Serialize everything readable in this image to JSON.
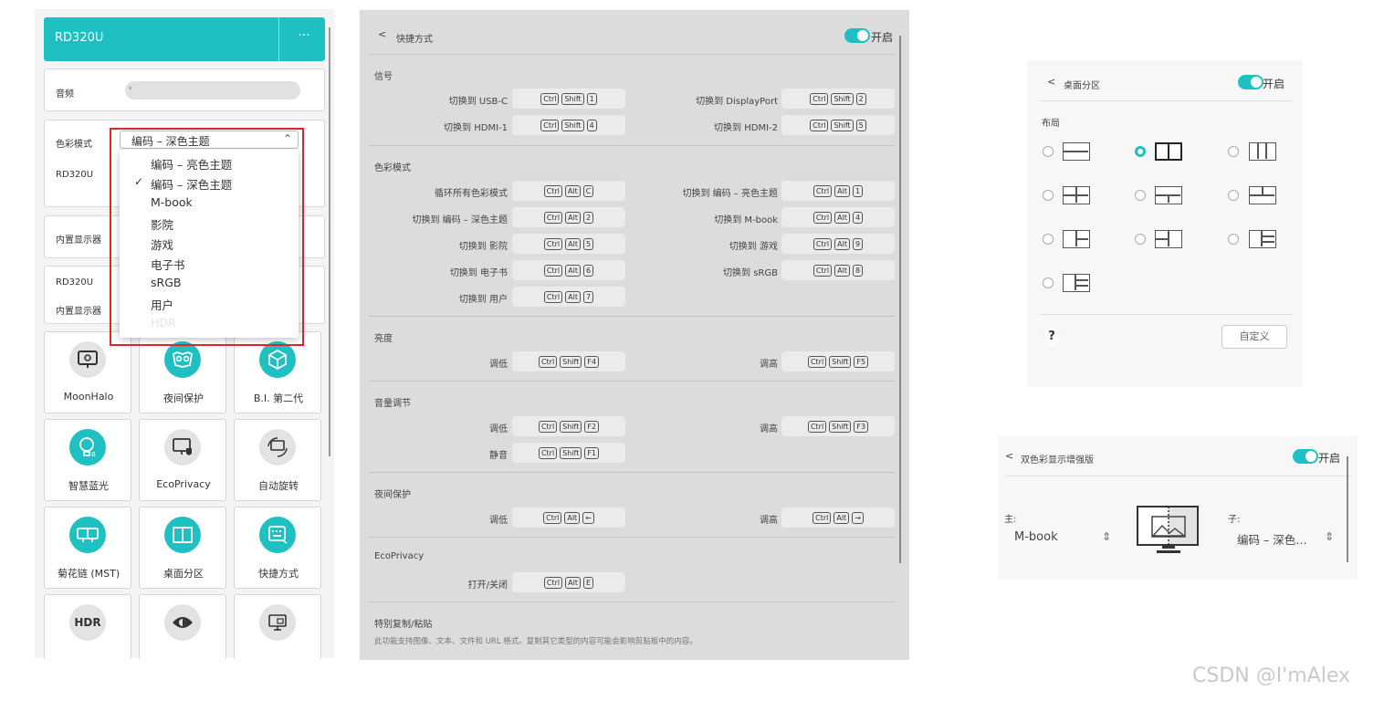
{
  "panel1": {
    "header": {
      "title": "RD320U",
      "more": "···"
    },
    "audio": {
      "label": "音频",
      "icon": "speaker-icon"
    },
    "color_mode": {
      "label": "色彩模式",
      "selected": "编码 – 深色主题",
      "secondary_label": "RD320U",
      "options": [
        {
          "label": "编码 – 亮色主题",
          "checked": false
        },
        {
          "label": "编码 – 深色主题",
          "checked": true
        },
        {
          "label": "M-book",
          "checked": false
        },
        {
          "label": "影院",
          "checked": false
        },
        {
          "label": "游戏",
          "checked": false
        },
        {
          "label": "电子书",
          "checked": false
        },
        {
          "label": "sRGB",
          "checked": false
        },
        {
          "label": "用户",
          "checked": false
        },
        {
          "label": "HDR",
          "checked": false
        }
      ]
    },
    "builtin_display_1": {
      "label": "内置显示器"
    },
    "display_pair": {
      "top": "RD320U",
      "bottom": "内置显示器"
    },
    "tiles": [
      {
        "label": "MoonHalo",
        "icon": "moonhalo-icon",
        "style": "gray"
      },
      {
        "label": "夜间保护",
        "icon": "owl-icon",
        "style": "teal"
      },
      {
        "label": "B.I. 第二代",
        "icon": "cube-icon",
        "style": "teal"
      },
      {
        "label": "智慧蓝光",
        "icon": "bulb-icon",
        "style": "teal"
      },
      {
        "label": "EcoPrivacy",
        "icon": "privacy-icon",
        "style": "gray"
      },
      {
        "label": "自动旋转",
        "icon": "rotate-icon",
        "style": "gray"
      },
      {
        "label": "菊花链 (MST)",
        "icon": "daisy-chain-icon",
        "style": "teal"
      },
      {
        "label": "桌面分区",
        "icon": "desktop-partition-icon",
        "style": "teal"
      },
      {
        "label": "快捷方式",
        "icon": "keyboard-icon",
        "style": "teal"
      },
      {
        "label": "",
        "icon": "hdr-icon",
        "style": "gray",
        "badge": "HDR"
      },
      {
        "label": "",
        "icon": "eye-icon",
        "style": "gray"
      },
      {
        "label": "",
        "icon": "monitor-icon",
        "style": "gray"
      }
    ]
  },
  "panel2": {
    "back": "<",
    "title": "快捷方式",
    "toggle_label": "开启",
    "sections": {
      "signal": "信号",
      "color": "色彩模式",
      "brightness": "亮度",
      "volume": "音量调节",
      "night": "夜间保护",
      "eco": "EcoPrivacy",
      "copy": "特别复制/粘贴"
    },
    "rows": {
      "usbc": {
        "label": "切换到 USB-C",
        "keys": [
          "Ctrl",
          "Shift",
          "1"
        ]
      },
      "dp": {
        "label": "切换到 DisplayPort",
        "keys": [
          "Ctrl",
          "Shift",
          "2"
        ]
      },
      "hdmi1": {
        "label": "切换到 HDMI-1",
        "keys": [
          "Ctrl",
          "Shift",
          "4"
        ]
      },
      "hdmi2": {
        "label": "切换到 HDMI-2",
        "keys": [
          "Ctrl",
          "Shift",
          "5"
        ]
      },
      "cycle": {
        "label": "循环所有色彩模式",
        "keys": [
          "Ctrl",
          "Alt",
          "C"
        ]
      },
      "code_light": {
        "label": "切换到 编码 – 亮色主题",
        "keys": [
          "Ctrl",
          "Alt",
          "1"
        ]
      },
      "code_dark": {
        "label": "切换到 编码 – 深色主题",
        "keys": [
          "Ctrl",
          "Alt",
          "2"
        ]
      },
      "mbook": {
        "label": "切换到 M-book",
        "keys": [
          "Ctrl",
          "Alt",
          "4"
        ]
      },
      "cinema": {
        "label": "切换到 影院",
        "keys": [
          "Ctrl",
          "Alt",
          "5"
        ]
      },
      "game": {
        "label": "切换到 游戏",
        "keys": [
          "Ctrl",
          "Alt",
          "9"
        ]
      },
      "ebook": {
        "label": "切换到 电子书",
        "keys": [
          "Ctrl",
          "Alt",
          "6"
        ]
      },
      "srgb": {
        "label": "切换到 sRGB",
        "keys": [
          "Ctrl",
          "Alt",
          "8"
        ]
      },
      "user": {
        "label": "切换到 用户",
        "keys": [
          "Ctrl",
          "Alt",
          "7"
        ]
      },
      "bright_down": {
        "label": "调低",
        "keys": [
          "Ctrl",
          "Shift",
          "F4"
        ]
      },
      "bright_up": {
        "label": "调高",
        "keys": [
          "Ctrl",
          "Shift",
          "F5"
        ]
      },
      "vol_down": {
        "label": "调低",
        "keys": [
          "Ctrl",
          "Shift",
          "F2"
        ]
      },
      "vol_up": {
        "label": "调高",
        "keys": [
          "Ctrl",
          "Shift",
          "F3"
        ]
      },
      "mute": {
        "label": "静音",
        "keys": [
          "Ctrl",
          "Shift",
          "F1"
        ]
      },
      "night_down": {
        "label": "调低",
        "keys": [
          "Ctrl",
          "Alt",
          "←"
        ]
      },
      "night_up": {
        "label": "调高",
        "keys": [
          "Ctrl",
          "Alt",
          "→"
        ]
      },
      "eco_toggle": {
        "label": "打开/关闭",
        "keys": [
          "Ctrl",
          "Alt",
          "E"
        ]
      }
    },
    "copy_desc": "此功能支持图像、文本、文件和 URL 格式。复制其它类型的内容可能会影响剪贴板中的内容。"
  },
  "panel3": {
    "back": "<",
    "title": "桌面分区",
    "toggle_label": "开启",
    "layout_label": "布局",
    "help": "?",
    "custom_button": "自定义",
    "selected_index": 1
  },
  "panel4": {
    "back": "<",
    "title": "双色彩显示增强版",
    "toggle_label": "开启",
    "main_label": "主:",
    "main_value": "M-book",
    "sub_label": "子:",
    "sub_value": "编码 – 深色…"
  },
  "watermark": "CSDN @I'mAlex",
  "colors": {
    "accent": "#1fc0c2",
    "highlight": "#e0242a"
  }
}
